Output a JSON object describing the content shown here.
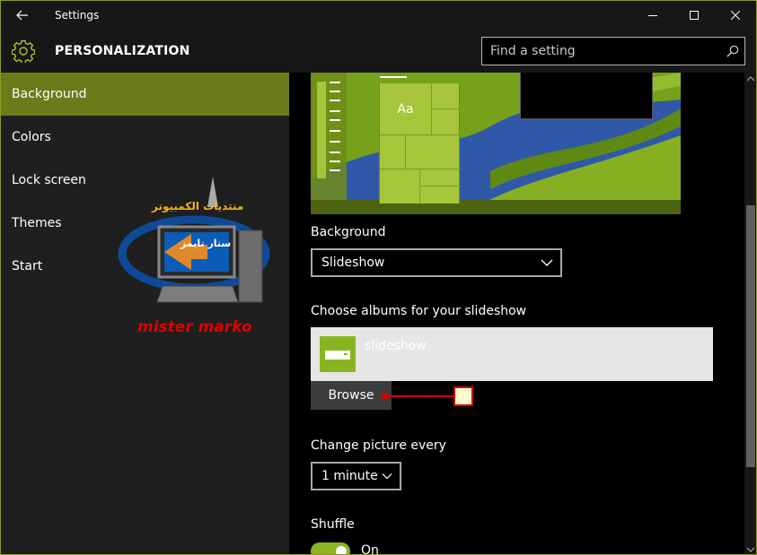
{
  "window": {
    "title": "Settings",
    "back_icon": "back-arrow-icon",
    "controls": [
      "minimize-icon",
      "maximize-icon",
      "close-icon"
    ]
  },
  "header": {
    "icon": "gear-icon",
    "title": "PERSONALIZATION",
    "accent": "#8ab522"
  },
  "search": {
    "placeholder": "Find a setting",
    "icon": "search-icon"
  },
  "sidebar": {
    "items": [
      {
        "label": "Background",
        "active": true
      },
      {
        "label": "Colors"
      },
      {
        "label": "Lock screen"
      },
      {
        "label": "Themes"
      },
      {
        "label": "Start"
      }
    ],
    "active_color": "#6c7a1a"
  },
  "watermark": {
    "caption": "mister marko",
    "arabic_title": "منتديات الكمبيوتر",
    "arabic_subtitle": "ستار تايمز"
  },
  "preview": {
    "tile_label": "Aa"
  },
  "background_section": {
    "label": "Background",
    "value": "Slideshow"
  },
  "albums_section": {
    "label": "Choose albums for your slideshow",
    "album_name": "slideshow",
    "browse_label": "Browse"
  },
  "interval_section": {
    "label": "Change picture every",
    "value": "1 minute"
  },
  "shuffle_section": {
    "label": "Shuffle",
    "state": "On",
    "toggle_on": true
  }
}
